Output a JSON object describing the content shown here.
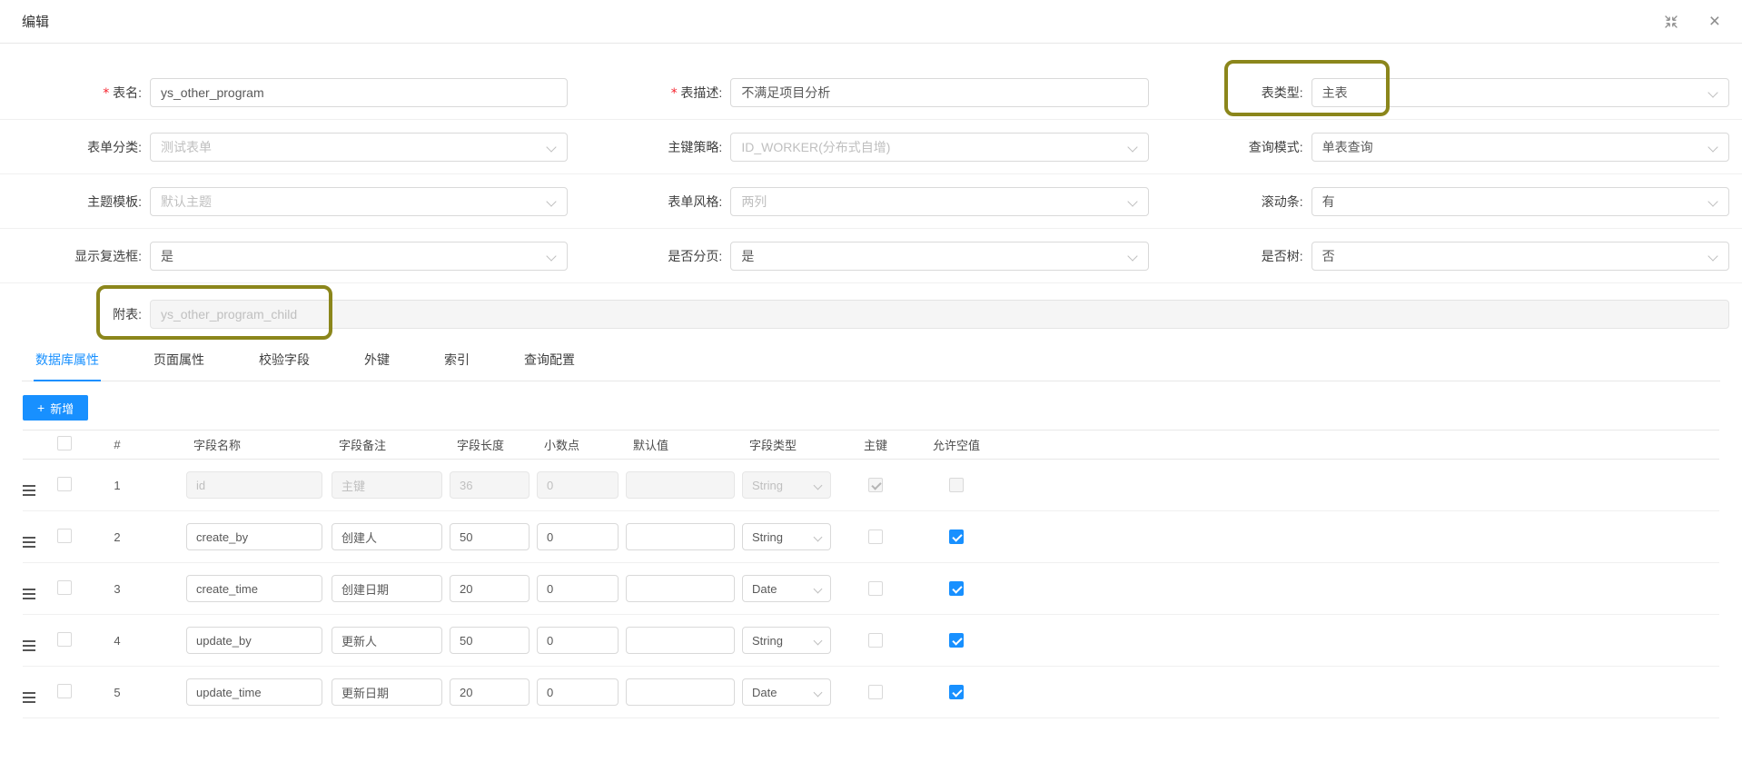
{
  "colors": {
    "accent": "#1890ff",
    "highlight_box": "#8b861b",
    "required_mark": "#f5222d",
    "checkbox_checked": "#1890ff"
  },
  "icons": {
    "fullscreen": "fullscreen-exit",
    "close": "×",
    "add": "+",
    "dropdown": "chevron-down",
    "drag": "drag-handle"
  },
  "modal": {
    "title": "编辑"
  },
  "form": {
    "table_name": {
      "label": "表名:",
      "required": "*",
      "value": "ys_other_program"
    },
    "table_desc": {
      "label": "表描述:",
      "required": "*",
      "value": "不满足项目分析"
    },
    "table_type": {
      "label": "表类型:",
      "value": "主表"
    },
    "form_category": {
      "label": "表单分类:",
      "value": "测试表单"
    },
    "pk_strategy": {
      "label": "主键策略:",
      "value": "ID_WORKER(分布式自增)"
    },
    "query_mode": {
      "label": "查询模式:",
      "value": "单表查询"
    },
    "theme_template": {
      "label": "主题模板:",
      "value": "默认主题"
    },
    "form_style": {
      "label": "表单风格:",
      "value": "两列"
    },
    "scrollbar": {
      "label": "滚动条:",
      "value": "有"
    },
    "show_checkbox": {
      "label": "显示复选框:",
      "value": "是"
    },
    "is_paging": {
      "label": "是否分页:",
      "value": "是"
    },
    "is_tree": {
      "label": "是否树:",
      "value": "否"
    },
    "sub_table": {
      "label": "附表:",
      "value": "ys_other_program_child",
      "disabled": true
    }
  },
  "tabs": [
    {
      "label": "数据库属性",
      "active": true
    },
    {
      "label": "页面属性"
    },
    {
      "label": "校验字段"
    },
    {
      "label": "外键"
    },
    {
      "label": "索引"
    },
    {
      "label": "查询配置"
    }
  ],
  "toolbar": {
    "add_label": "新增"
  },
  "table": {
    "headers": {
      "index": "#",
      "name": "字段名称",
      "comment": "字段备注",
      "length": "字段长度",
      "decimal": "小数点",
      "default": "默认值",
      "type": "字段类型",
      "pk": "主键",
      "allow_null": "允许空值"
    },
    "rows": [
      {
        "index": "1",
        "name": "id",
        "comment": "主键",
        "length": "36",
        "decimal": "0",
        "default": "",
        "type": "String",
        "pk": true,
        "allow_null": false,
        "disabled": true
      },
      {
        "index": "2",
        "name": "create_by",
        "comment": "创建人",
        "length": "50",
        "decimal": "0",
        "default": "",
        "type": "String",
        "pk": false,
        "allow_null": true
      },
      {
        "index": "3",
        "name": "create_time",
        "comment": "创建日期",
        "length": "20",
        "decimal": "0",
        "default": "",
        "type": "Date",
        "pk": false,
        "allow_null": true
      },
      {
        "index": "4",
        "name": "update_by",
        "comment": "更新人",
        "length": "50",
        "decimal": "0",
        "default": "",
        "type": "String",
        "pk": false,
        "allow_null": true
      },
      {
        "index": "5",
        "name": "update_time",
        "comment": "更新日期",
        "length": "20",
        "decimal": "0",
        "default": "",
        "type": "Date",
        "pk": false,
        "allow_null": true
      }
    ]
  }
}
